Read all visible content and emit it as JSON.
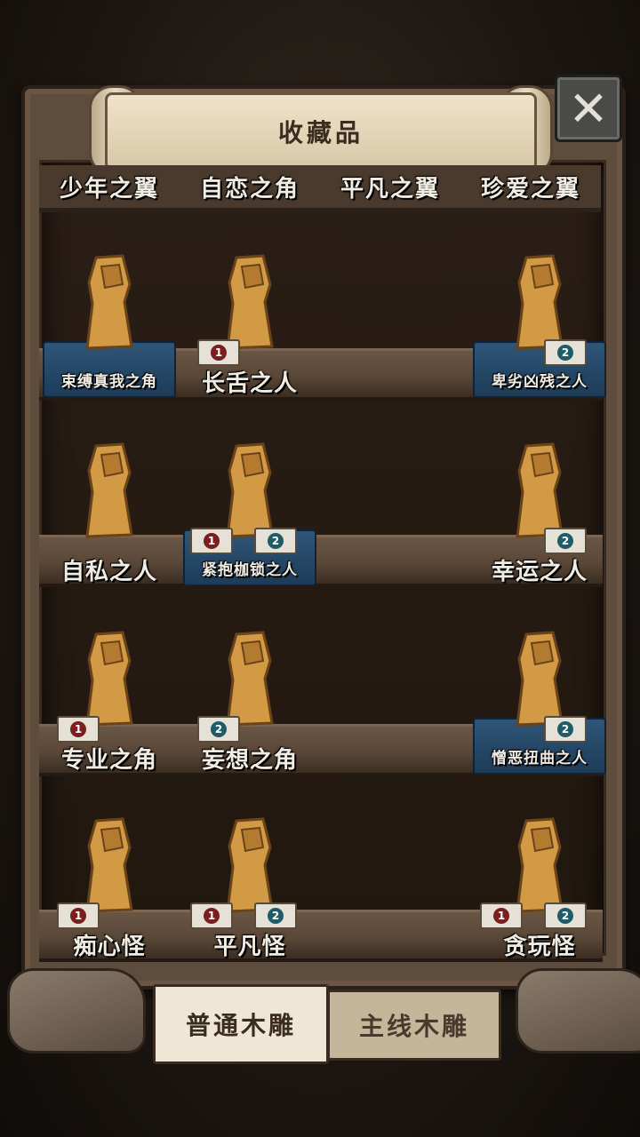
{
  "header": {
    "title": "收藏品",
    "close_icon": "close-x-icon"
  },
  "top_labels": [
    "少年之翼",
    "自恋之角",
    "平凡之翼",
    "珍爱之翼"
  ],
  "shelves": [
    {
      "items": [
        {
          "name": "束缚真我之角",
          "style": "small-blue",
          "cards": []
        },
        {
          "name": "长舌之人",
          "style": "normal",
          "cards": [
            "1"
          ]
        },
        {
          "name": "卑劣凶残之人",
          "style": "small-blue",
          "cards": [
            "2"
          ]
        }
      ]
    },
    {
      "items": [
        {
          "name": "自私之人",
          "style": "normal",
          "cards": []
        },
        {
          "name": "紧抱枷锁之人",
          "style": "small-blue",
          "cards": [
            "1",
            "2"
          ]
        },
        {
          "name": "幸运之人",
          "style": "normal",
          "cards": [
            "2"
          ]
        }
      ]
    },
    {
      "items": [
        {
          "name": "专业之角",
          "style": "normal",
          "cards": [
            "1"
          ]
        },
        {
          "name": "妄想之角",
          "style": "normal",
          "cards": [
            "2"
          ]
        },
        {
          "name": "憎恶扭曲之人",
          "style": "small-blue",
          "cards": [
            "2"
          ]
        }
      ]
    },
    {
      "items": [
        {
          "name": "痴心怪",
          "style": "normal",
          "cards": [
            "1"
          ]
        },
        {
          "name": "平凡怪",
          "style": "normal",
          "cards": [
            "1",
            "2"
          ]
        },
        {
          "name": "贪玩怪",
          "style": "normal",
          "cards": [
            "1",
            "2"
          ]
        }
      ]
    }
  ],
  "tabs": {
    "active": "普通木雕",
    "inactive": "主线木雕"
  },
  "colors": {
    "wood": "#5e4c3c",
    "statue": "#d29a45",
    "pedestal": "#2f5678"
  }
}
